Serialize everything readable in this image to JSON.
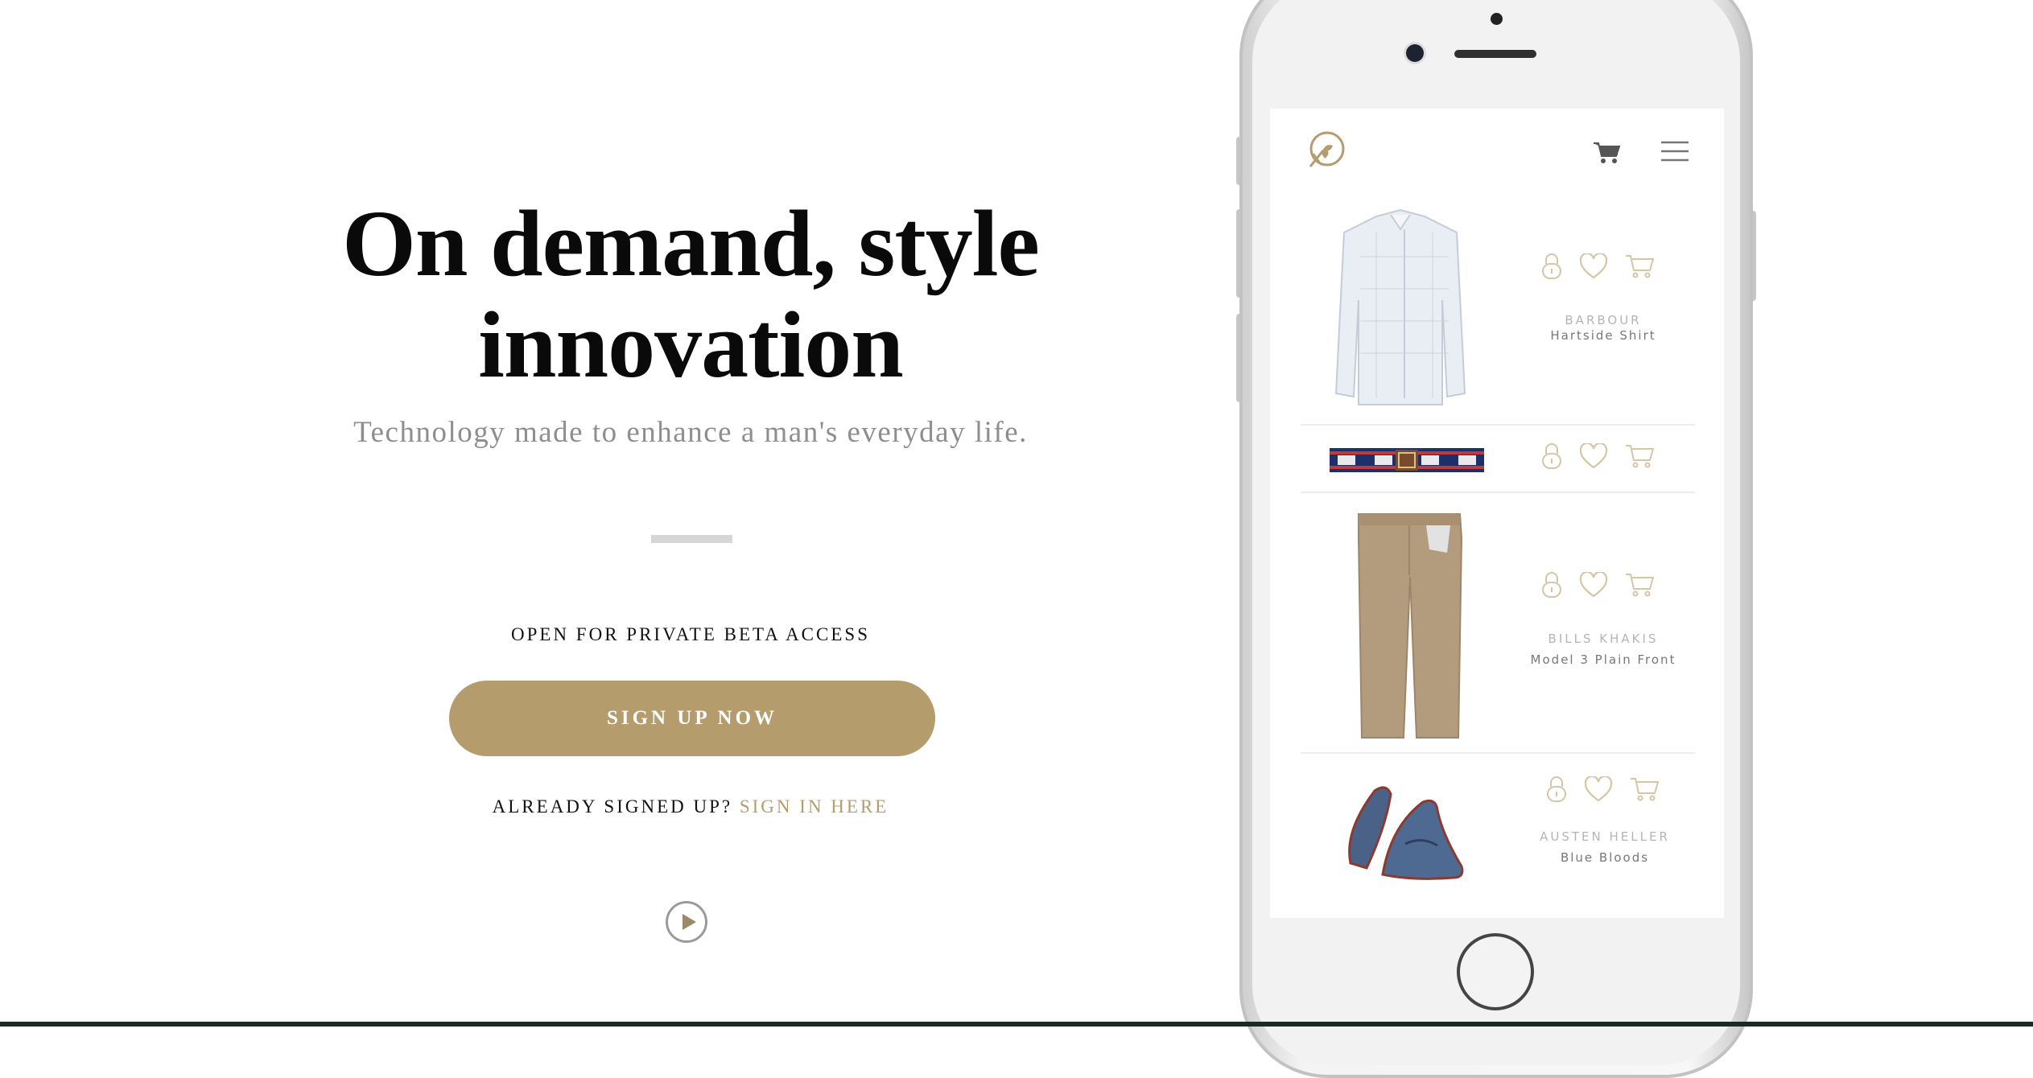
{
  "hero": {
    "title": "On demand, style innovation",
    "subtitle": "Technology made to enhance a man's everyday life.",
    "beta_label": "OPEN FOR PRIVATE BETA ACCESS",
    "signup_label": "SIGN UP NOW",
    "already_text": "ALREADY SIGNED UP?",
    "signin_label": "SIGN IN HERE"
  },
  "colors": {
    "accent": "#b49c6c",
    "text": "#0a0a0a",
    "muted": "#8e8e8e"
  },
  "app": {
    "icons": [
      "logo-icon",
      "cart-icon",
      "menu-icon"
    ],
    "products": [
      {
        "brand": "BARBOUR",
        "name": "Hartside Shirt",
        "image": "shirt-image"
      },
      {
        "brand": "",
        "name": "",
        "image": "belt-image"
      },
      {
        "brand": "BILLS KHAKIS",
        "name": "Model 3 Plain Front",
        "image": "khakis-image"
      },
      {
        "brand": "AUSTEN HELLER",
        "name": "Blue Bloods",
        "image": "loafers-image"
      }
    ]
  }
}
